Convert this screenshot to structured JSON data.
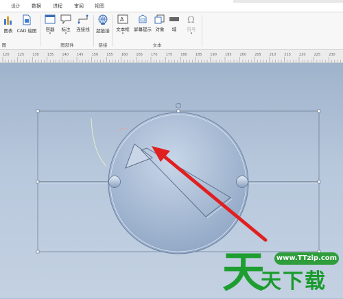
{
  "tabs": [
    "设计",
    "数据",
    "进程",
    "审阅",
    "视图"
  ],
  "ribbon": {
    "buttons": {
      "chart": "图表",
      "cad": "CAD 绘图",
      "container": "容器",
      "callout": "标注",
      "connector": "连接线",
      "hyperlink": "超链接",
      "textbox": "文本框",
      "screentip": "屏幕提示",
      "object": "对象",
      "field": "域",
      "symbol": "符号"
    },
    "groups": {
      "illustrations_tail": "图",
      "diagram_parts": "图部件",
      "links": "链接",
      "text": "文本"
    }
  },
  "ruler": {
    "ticks": [
      "120",
      "125",
      "130",
      "135",
      "140",
      "145",
      "150",
      "155",
      "160",
      "165",
      "170",
      "175",
      "180",
      "185",
      "190",
      "195",
      "200",
      "205",
      "210",
      "215",
      "220",
      "225",
      "230"
    ]
  },
  "watermark": {
    "url": "www.TTzip.com",
    "big_char": "天",
    "text": "天下载"
  },
  "colors": {
    "arrow": "#e02020",
    "canvas_top": "#9fb3cc",
    "canvas_bottom": "#c3d1e2",
    "brand_green": "#1e9e30"
  }
}
